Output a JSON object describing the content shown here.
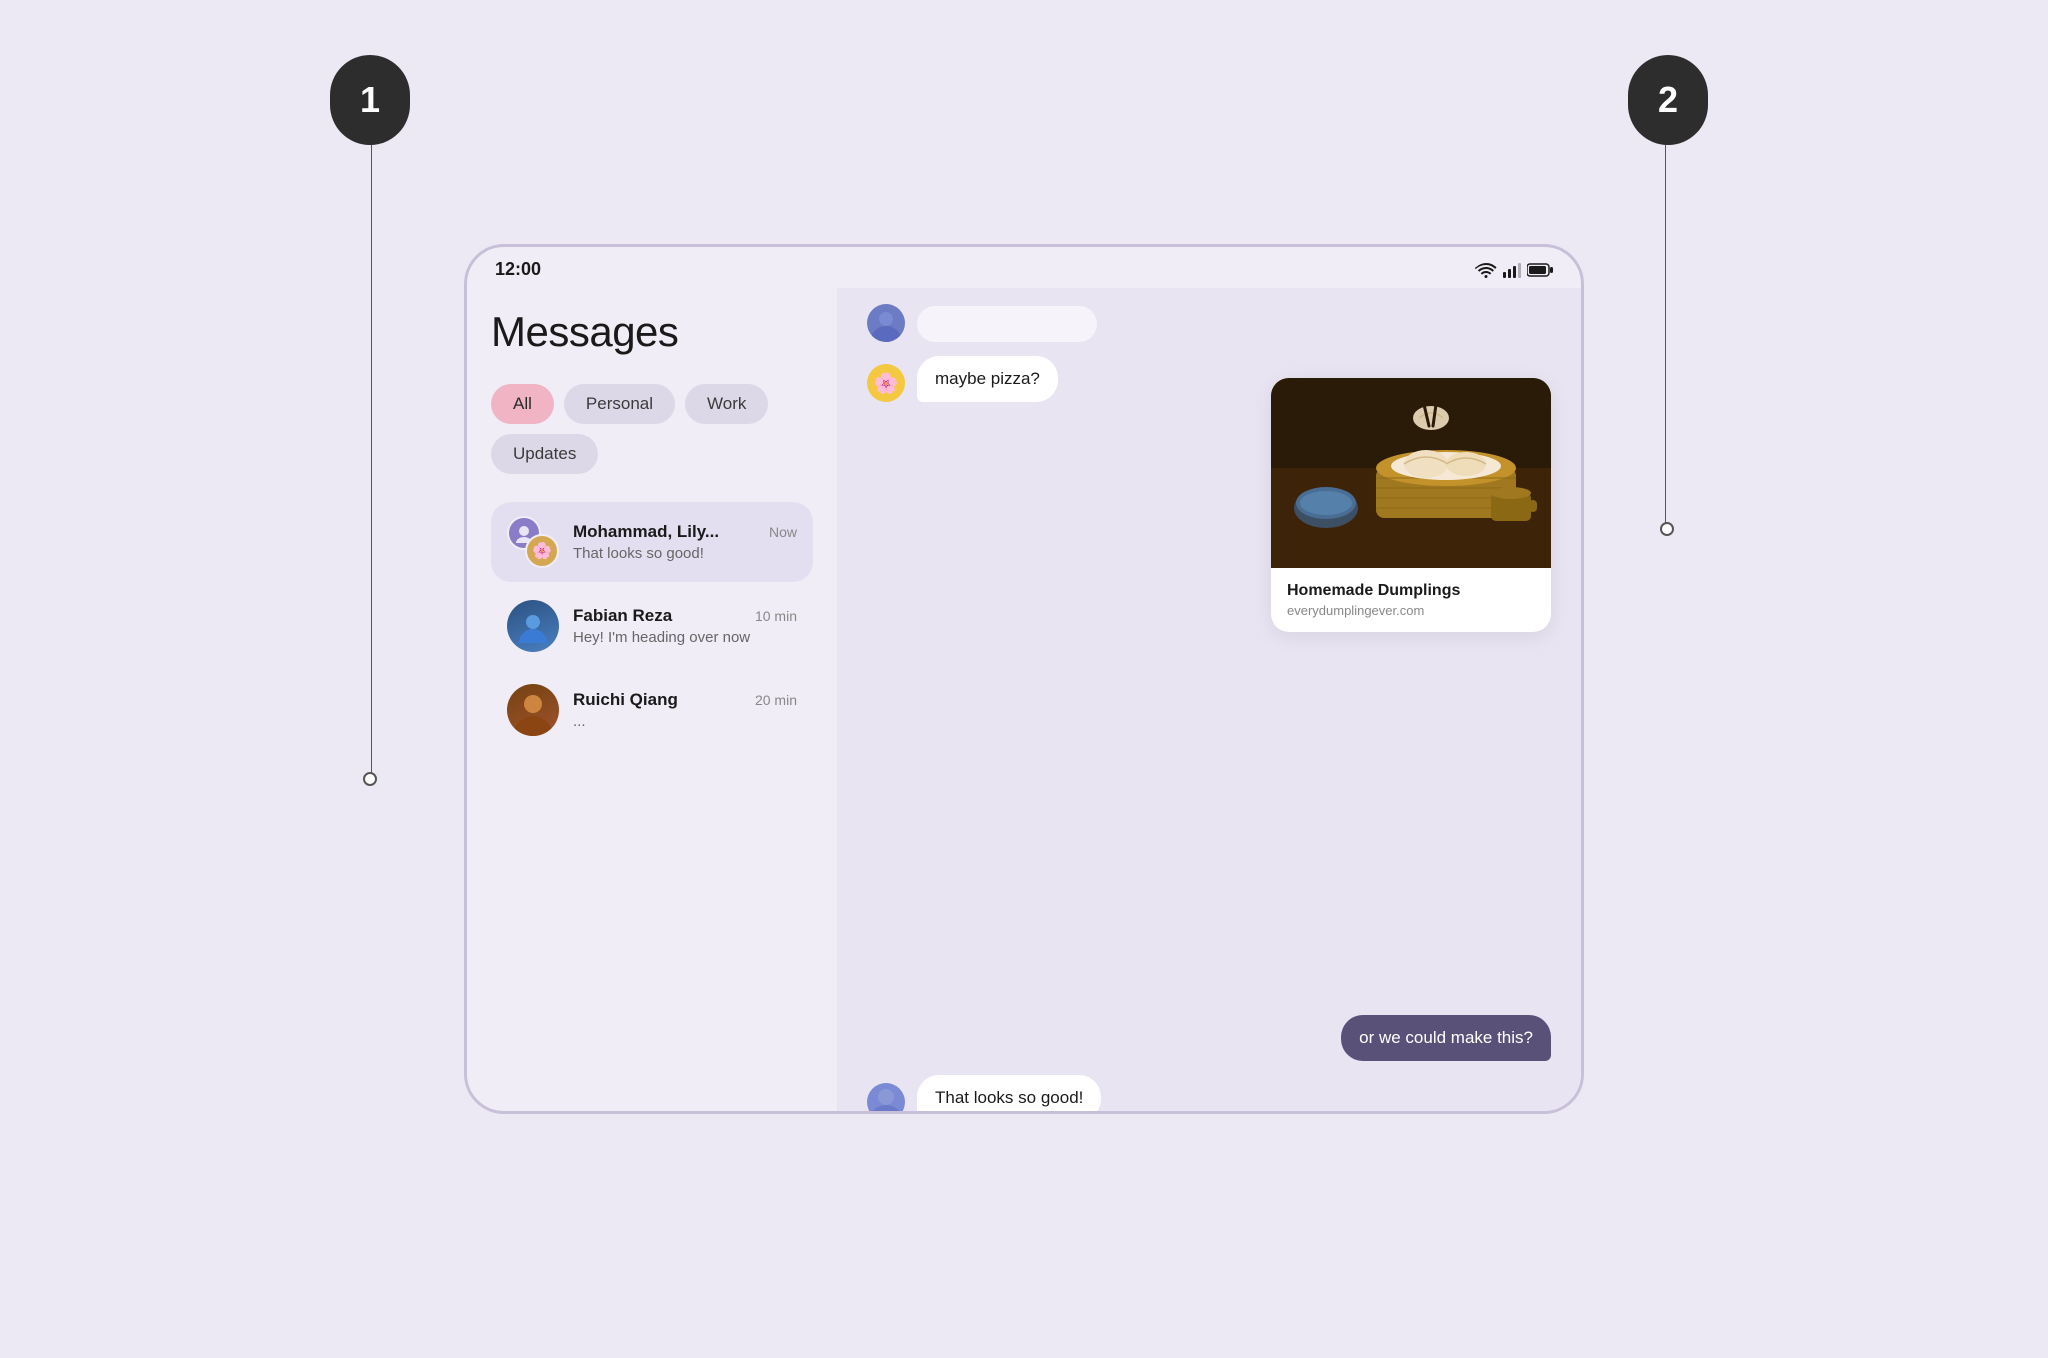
{
  "app": {
    "background_color": "#ede9f4"
  },
  "annotations": {
    "circle_1_label": "1",
    "circle_2_label": "2"
  },
  "device": {
    "status_bar": {
      "time": "12:00"
    },
    "left_panel": {
      "title": "Messages",
      "filter_tabs": [
        {
          "label": "All",
          "active": true
        },
        {
          "label": "Personal",
          "active": false
        },
        {
          "label": "Work",
          "active": false
        },
        {
          "label": "Updates",
          "active": false
        }
      ],
      "conversations": [
        {
          "name": "Mohammad, Lily...",
          "preview": "That looks so good!",
          "time": "Now",
          "active": true
        },
        {
          "name": "Fabian Reza",
          "preview": "Hey! I'm heading over now",
          "time": "10 min",
          "active": false
        },
        {
          "name": "Ruichi Qiang",
          "preview": "...",
          "time": "20 min",
          "active": false
        }
      ]
    },
    "chat_panel": {
      "messages": [
        {
          "type": "incoming",
          "text": "maybe pizza?",
          "avatar": "🌸"
        }
      ],
      "link_card": {
        "title": "Homemade Dumplings",
        "url": "everydumplingever.com"
      },
      "outgoing_message": "or we could make this?",
      "bottom_incoming": "That looks so good!"
    }
  }
}
